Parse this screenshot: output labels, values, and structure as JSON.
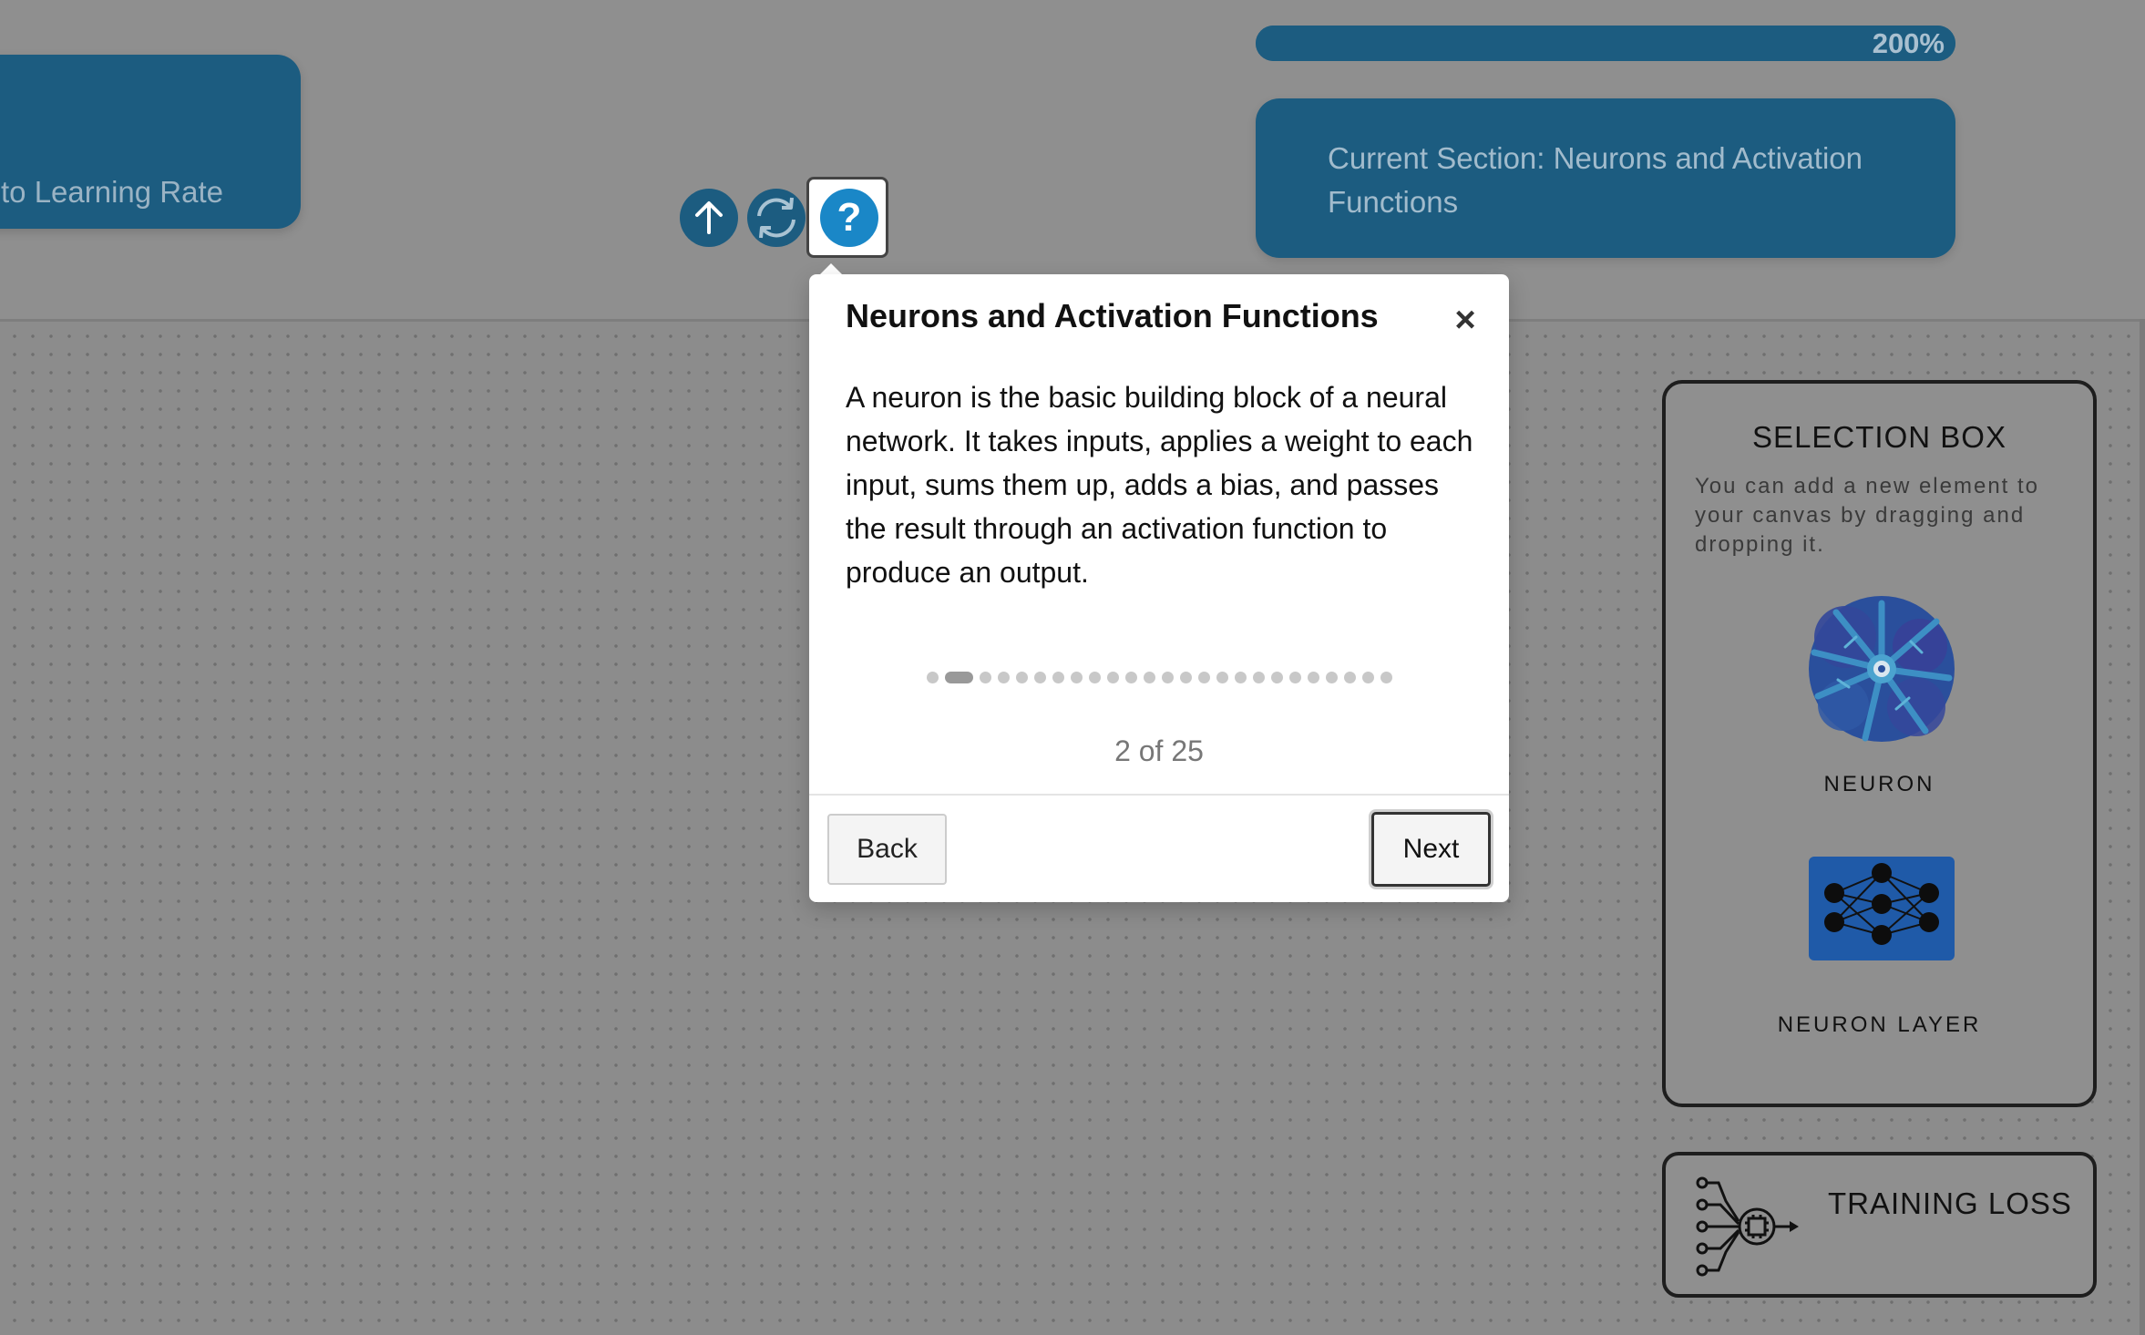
{
  "toolbar": {
    "topic_label": "to Learning Rate",
    "progress_text": "200%",
    "progress_value": 1.0,
    "current_section": "Current Section: Neurons and Activation Functions",
    "icons": [
      "arrow-up-icon",
      "refresh-icon",
      "help-icon"
    ]
  },
  "tour": {
    "title": "Neurons and Activation Functions",
    "close_symbol": "×",
    "body": "A neuron is the basic building block of a neural network. It takes inputs, applies a weight to each input, sums them up, adds a bias, and passes the result through an activation function to produce an output.",
    "current_step": 2,
    "total_steps": 25,
    "counter": "2 of 25",
    "back_label": "Back",
    "next_label": "Next"
  },
  "selection_box": {
    "title": "SELECTION BOX",
    "description": "You can add a new element to your canvas by dragging and dropping it.",
    "items": [
      {
        "label": "NEURON",
        "icon": "neuron-icon"
      },
      {
        "label": "NEURON LAYER",
        "icon": "neuron-layer-icon"
      }
    ]
  },
  "training_loss": {
    "label": "TRAINING LOSS",
    "icon": "processor-network-icon"
  },
  "colors": {
    "primary": "#1c5c80",
    "help_blue": "#1a87c7",
    "background": "#8f8f8f"
  }
}
